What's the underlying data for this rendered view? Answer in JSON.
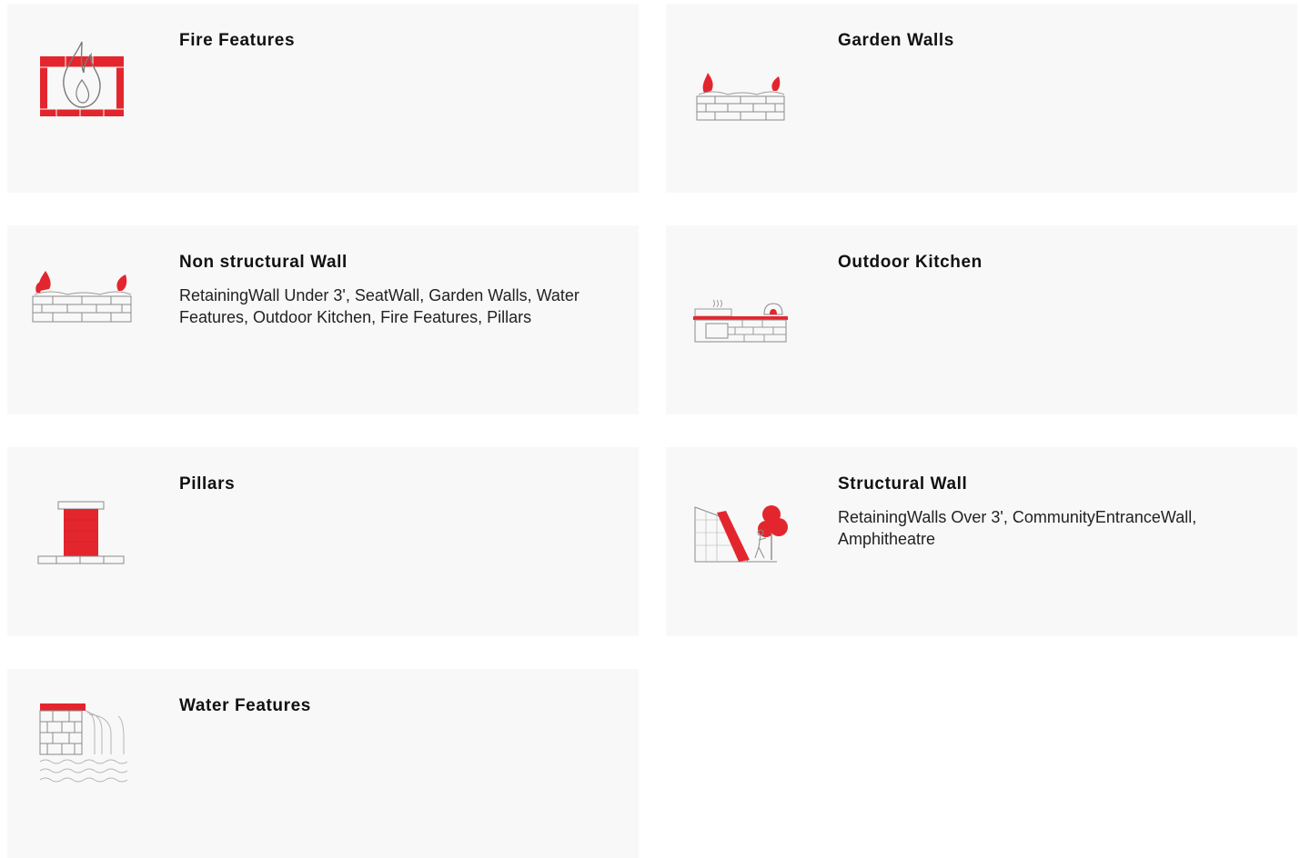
{
  "cards": [
    {
      "title": "Fire Features",
      "description": "",
      "icon": "fire-feature-icon"
    },
    {
      "title": "Garden Walls",
      "description": "",
      "icon": "garden-wall-icon"
    },
    {
      "title": "Non structural Wall",
      "description": "RetainingWall Under 3', SeatWall, Garden Walls, Water Features, Outdoor Kitchen, Fire Features, Pillars",
      "icon": "non-structural-wall-icon"
    },
    {
      "title": "Outdoor Kitchen",
      "description": "",
      "icon": "outdoor-kitchen-icon"
    },
    {
      "title": "Pillars",
      "description": "",
      "icon": "pillar-icon"
    },
    {
      "title": "Structural Wall",
      "description": "RetainingWalls Over 3', CommunityEntranceWall, Amphitheatre",
      "icon": "structural-wall-icon"
    },
    {
      "title": "Water Features",
      "description": "",
      "icon": "water-feature-icon"
    }
  ],
  "colors": {
    "accent": "#e3262e",
    "card_bg": "#f8f8f8",
    "line": "#8a8a8a"
  }
}
